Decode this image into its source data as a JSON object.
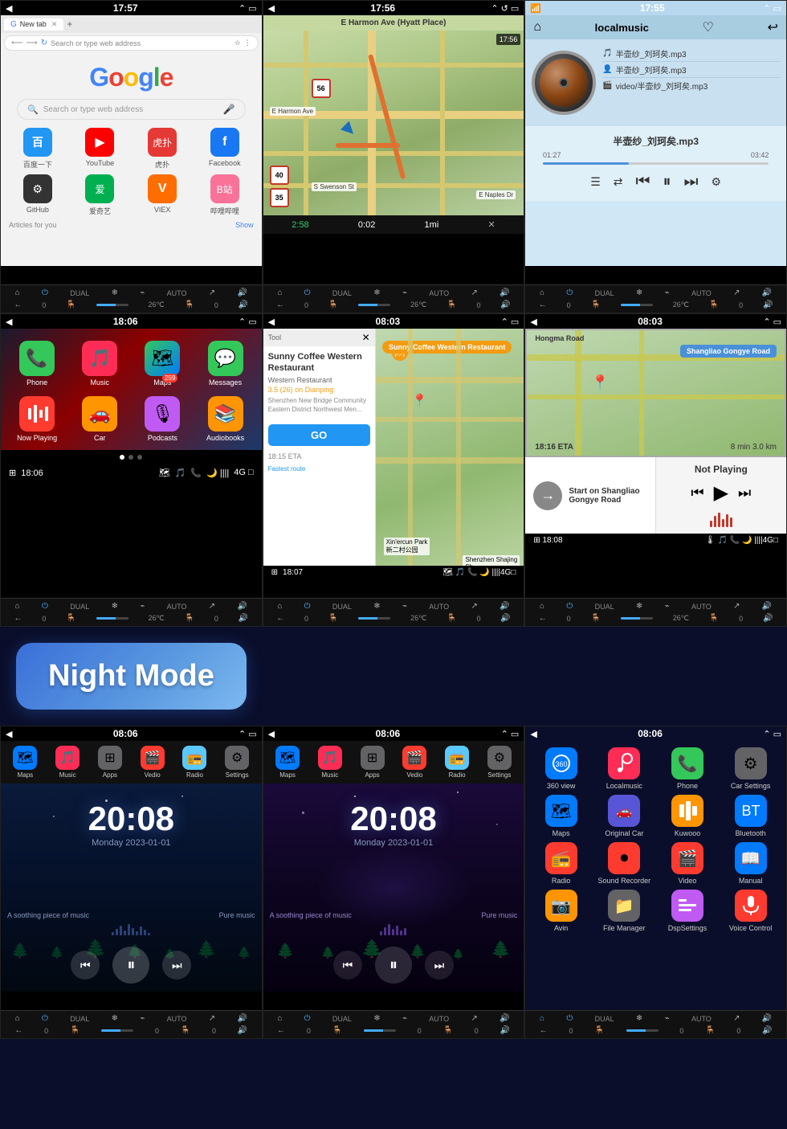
{
  "screens": {
    "row1": [
      {
        "id": "chrome",
        "status_time": "17:57",
        "tab_label": "New tab",
        "address_placeholder": "Search or type web address",
        "shortcuts": [
          {
            "label": "百度一下",
            "color": "#2196F3",
            "icon": "🔵"
          },
          {
            "label": "YouTube",
            "color": "#FF0000",
            "icon": "▶"
          },
          {
            "label": "虎扑",
            "color": "#E53935",
            "icon": "🏅"
          },
          {
            "label": "Facebook",
            "color": "#1877F2",
            "icon": "f"
          },
          {
            "label": "GitHub",
            "color": "#333",
            "icon": "⚫"
          },
          {
            "label": "爱奇艺",
            "color": "#00B050",
            "icon": "🎬"
          },
          {
            "label": "VIEX",
            "color": "#FF6D00",
            "icon": "V"
          },
          {
            "label": "哔哩哔哩",
            "color": "#FB7299",
            "icon": "B"
          }
        ],
        "articles_label": "Articles for you",
        "show_label": "Show"
      },
      {
        "id": "navigation",
        "status_time": "17:56",
        "destination": "E Harmon Ave (Hyatt Place)",
        "eta": "2:58",
        "distance": "0:02",
        "map_scale": "1mi",
        "speed_limits": [
          "40",
          "35",
          "56"
        ]
      },
      {
        "id": "localmusic",
        "status_time": "17:55",
        "title": "localmusic",
        "tracks": [
          {
            "icon": "🎵",
            "name": "半壶纱_刘珂矣.mp3"
          },
          {
            "icon": "👤",
            "name": "半壶纱_刘珂矣.mp3"
          },
          {
            "icon": "🎬",
            "name": "video/半壶纱_刘珂矣.mp3"
          }
        ],
        "current_track": "半壶纱_刘珂矣.mp3",
        "current_time": "01:27",
        "total_time": "03:42",
        "progress_pct": 38
      }
    ],
    "row2": [
      {
        "id": "carplay_home",
        "status_time": "18:06",
        "apps_row1": [
          {
            "label": "Phone",
            "color": "#34C759",
            "icon": "📞"
          },
          {
            "label": "Music",
            "color": "#FF2D55",
            "icon": "🎵"
          },
          {
            "label": "Maps",
            "color": "#FF9500",
            "icon": "🗺"
          },
          {
            "label": "Messages",
            "color": "#34C759",
            "icon": "💬"
          }
        ],
        "apps_row2": [
          {
            "label": "Now Playing",
            "color": "#FF3B30",
            "icon": "🎙"
          },
          {
            "label": "Car",
            "color": "#FF9500",
            "icon": "🚗"
          },
          {
            "label": "Podcasts",
            "color": "#BF5AF2",
            "icon": "🎙"
          },
          {
            "label": "Audiobooks",
            "color": "#FF9500",
            "icon": "📚"
          }
        ],
        "dock_time": "18:06",
        "messages_badge": "259"
      },
      {
        "id": "carplay_nav",
        "status_time": "08:03",
        "restaurant_name": "Sunny Coffee Western Restaurant",
        "restaurant_type": "Western Restaurant",
        "rating": "3.5 (26) on Dianping",
        "address": "Shenzhen New Bridge Community Eastern District Northwest Men...",
        "eta": "18:15 ETA",
        "route_label": "Fastest route",
        "go_label": "GO",
        "dock_time": "18:07"
      },
      {
        "id": "carplay_split",
        "status_time": "08:03",
        "road_label": "Shangliao Gongye Road",
        "eta": "18:16 ETA",
        "eta_details": "8 min  3.0 km",
        "nav_instruction": "Start on Shangliao Gongye Road",
        "music_label": "Not Playing",
        "dock_time": "18:08"
      }
    ],
    "night_banner": {
      "label": "Night Mode"
    },
    "row3": [
      {
        "id": "night1",
        "status_time": "08:06",
        "apps": [
          {
            "label": "Maps",
            "color": "#007AFF",
            "icon": "🗺"
          },
          {
            "label": "Music",
            "color": "#FF2D55",
            "icon": "🎵"
          },
          {
            "label": "Apps",
            "color": "#636366",
            "icon": "⚏"
          },
          {
            "label": "Vedio",
            "color": "#FF3B30",
            "icon": "🎬"
          },
          {
            "label": "Radio",
            "color": "#5AC8FA",
            "icon": "📻"
          },
          {
            "label": "Settings",
            "color": "#636366",
            "icon": "⚙"
          }
        ],
        "clock": "20:08",
        "day_date": "Monday  2023-01-01",
        "music_prev": "⏮",
        "music_pause": "⏸",
        "music_next": "⏭",
        "song_label_left": "A soothing piece of music",
        "song_label_right": "Pure music"
      },
      {
        "id": "night2",
        "status_time": "08:06",
        "apps": [
          {
            "label": "Maps",
            "color": "#007AFF",
            "icon": "🗺"
          },
          {
            "label": "Music",
            "color": "#FF2D55",
            "icon": "🎵"
          },
          {
            "label": "Apps",
            "color": "#636366",
            "icon": "⚏"
          },
          {
            "label": "Vedio",
            "color": "#FF3B30",
            "icon": "🎬"
          },
          {
            "label": "Radio",
            "color": "#5AC8FA",
            "icon": "📻"
          },
          {
            "label": "Settings",
            "color": "#636366",
            "icon": "⚙"
          }
        ],
        "clock": "20:08",
        "day_date": "Monday  2023-01-01",
        "song_label_left": "A soothing piece of music",
        "song_label_right": "Pure music"
      },
      {
        "id": "night3",
        "status_time": "08:06",
        "grid_apps": [
          {
            "label": "360 view",
            "color": "#007AFF",
            "icon": "🔵"
          },
          {
            "label": "Localmusic",
            "color": "#FF2D55",
            "icon": "🎵"
          },
          {
            "label": "Phone",
            "color": "#34C759",
            "icon": "📞"
          },
          {
            "label": "Car Settings",
            "color": "#636366",
            "icon": "⚙"
          },
          {
            "label": "Maps",
            "color": "#007AFF",
            "icon": "🗺"
          },
          {
            "label": "Original Car",
            "color": "#5856D6",
            "icon": "🚗"
          },
          {
            "label": "Kuwooo",
            "color": "#FF9500",
            "icon": "🎶"
          },
          {
            "label": "Bluetooth",
            "color": "#007AFF",
            "icon": "🔵"
          },
          {
            "label": "Radio",
            "color": "#FF3B30",
            "icon": "📻"
          },
          {
            "label": "Sound Recorder",
            "color": "#FF3B30",
            "icon": "⏺"
          },
          {
            "label": "Video",
            "color": "#FF3B30",
            "icon": "🎬"
          },
          {
            "label": "Manual",
            "color": "#007AFF",
            "icon": "📖"
          },
          {
            "label": "Avin",
            "color": "#FF9500",
            "icon": "📷"
          },
          {
            "label": "File Manager",
            "color": "#636366",
            "icon": "📁"
          },
          {
            "label": "DspSettings",
            "color": "#BF5AF2",
            "icon": "⚙"
          },
          {
            "label": "Voice Control",
            "color": "#FF3B30",
            "icon": "🎙"
          }
        ]
      }
    ]
  },
  "toolbar": {
    "home_icon": "⌂",
    "power_icon": "⏻",
    "dual_label": "DUAL",
    "snow_icon": "❄",
    "link_icon": "∞",
    "auto_label": "AUTO",
    "arrow_icon": "↗",
    "vol_icon": "🔊",
    "back_icon": "←",
    "zero": "0",
    "slider_label": "──",
    "seat_icon": "🪑",
    "temp_label": "26℃"
  },
  "colors": {
    "bg": "#0a0e2a",
    "night_badge_from": "#3a6fd8",
    "night_badge_to": "#7cb8f0"
  }
}
